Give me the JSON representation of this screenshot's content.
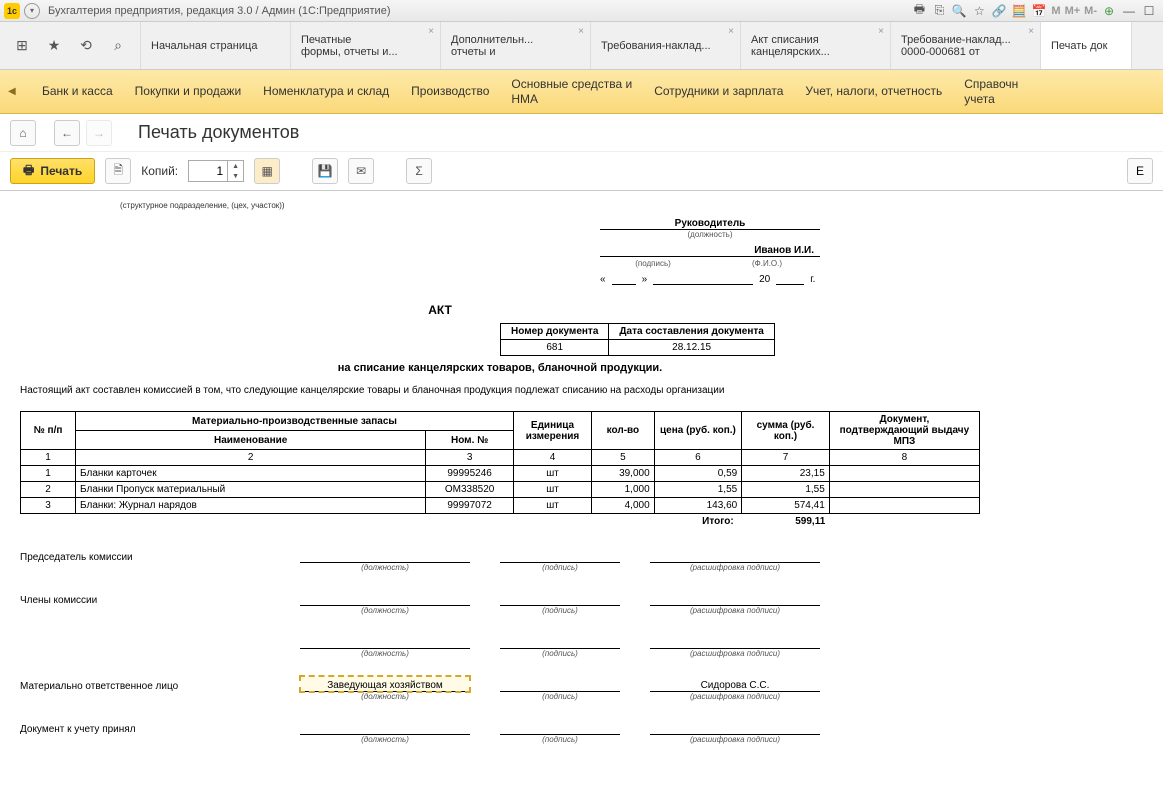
{
  "titlebar": {
    "app_title": "Бухгалтерия предприятия, редакция 3.0 / Админ  (1С:Предприятие)",
    "mem_labels": [
      "M",
      "M+",
      "M-"
    ]
  },
  "tabs": {
    "fixed_icons": [
      "apps",
      "star",
      "clip",
      "search"
    ],
    "items": [
      {
        "l1": "Начальная страница",
        "l2": "",
        "closable": false
      },
      {
        "l1": "Печатные",
        "l2": "формы, отчеты и...",
        "closable": true
      },
      {
        "l1": "Дополнительн...",
        "l2": "отчеты и",
        "closable": true
      },
      {
        "l1": "Требования-наклад...",
        "l2": "",
        "closable": true
      },
      {
        "l1": "Акт списания",
        "l2": "канцелярских...",
        "closable": true
      },
      {
        "l1": "Требование-наклад...",
        "l2": "0000-000681 от",
        "closable": true
      },
      {
        "l1": "Печать док",
        "l2": "",
        "closable": false
      }
    ],
    "active": 6
  },
  "mainnav": [
    "Банк и касса",
    "Покупки и продажи",
    "Номенклатура и склад",
    "Производство",
    "Основные средства и\nНМА",
    "Сотрудники и зарплата",
    "Учет, налоги, отчетность",
    "Справочн\nучета"
  ],
  "subbar": {
    "title": "Печать документов"
  },
  "actbar": {
    "print": "Печать",
    "copies_label": "Копий:",
    "copies_value": "1"
  },
  "doc": {
    "subunit_caption": "(структурное подразделение, (цех, участок))",
    "head_role": "Руководитель",
    "head_role_caption": "(должность)",
    "head_name": "Иванов И.И.",
    "sign_caption": "(подпись)",
    "fio_caption": "(Ф.И.О.)",
    "date_yr": "20",
    "date_g": "г.",
    "akt": "АКТ",
    "num_h1": "Номер документа",
    "num_h2": "Дата составления документа",
    "num_v1": "681",
    "num_v2": "28.12.15",
    "subtitle": "на списание канцелярских товаров, бланочной продукции.",
    "para": "Настоящий акт составлен комиссией в том, что следующие канцелярские товары и бланочная продукция подлежат списанию на расходы организации",
    "th": {
      "npp": "№ п/п",
      "group": "Материально-производственные запасы",
      "name": "Наименование",
      "nomno": "Ном. №",
      "unit": "Единица измерения",
      "qty": "кол-во",
      "price": "цена (руб. коп.)",
      "sum": "сумма (руб. коп.)",
      "docc": "Документ, подтверждающий выдачу МПЗ"
    },
    "colnums": [
      "1",
      "2",
      "3",
      "4",
      "5",
      "6",
      "7",
      "8"
    ],
    "rows": [
      {
        "n": "1",
        "name": "Бланки карточек",
        "nom": "99995246",
        "unit": "шт",
        "qty": "39,000",
        "price": "0,59",
        "sum": "23,15",
        "doc": ""
      },
      {
        "n": "2",
        "name": "Бланки Пропуск материальный",
        "nom": "ОМ338520",
        "unit": "шт",
        "qty": "1,000",
        "price": "1,55",
        "sum": "1,55",
        "doc": ""
      },
      {
        "n": "3",
        "name": "Бланки: Журнал нарядов",
        "nom": "99997072",
        "unit": "шт",
        "qty": "4,000",
        "price": "143,60",
        "sum": "574,41",
        "doc": ""
      }
    ],
    "total_label": "Итого:",
    "total_value": "599,11",
    "sig": {
      "chair": "Председатель комиссии",
      "members": "Члены комиссии",
      "resp": "Материально ответственное лицо",
      "resp_pos": "Заведующая хозяйством",
      "resp_name": "Сидорова С.С.",
      "accepted": "Документ к учету принял",
      "cap_pos": "(должность)",
      "cap_sign": "(подпись)",
      "cap_dec": "(расшифровка подписи)"
    }
  }
}
